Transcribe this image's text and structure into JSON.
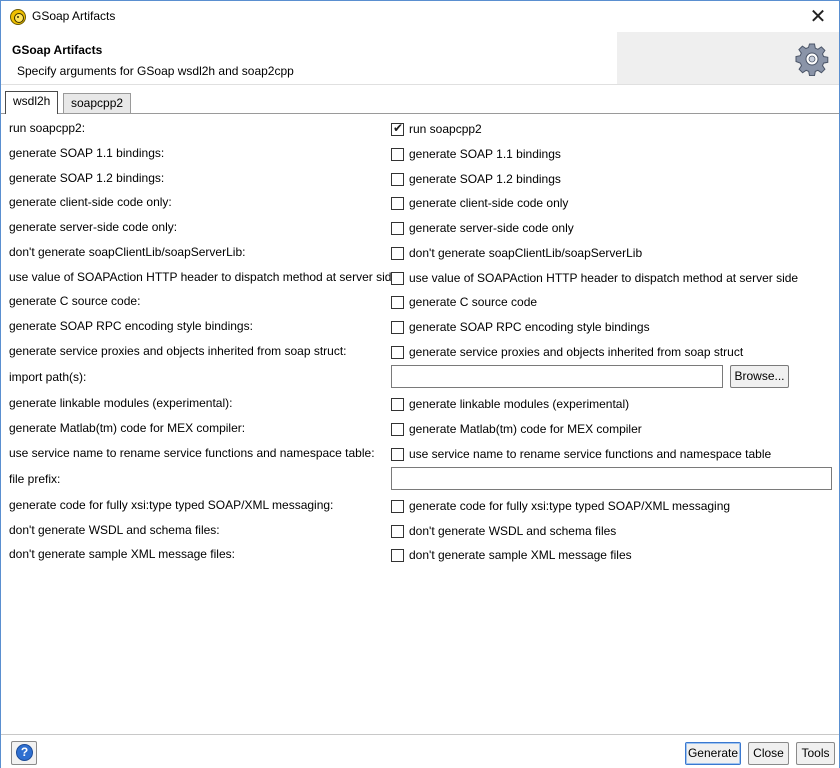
{
  "window": {
    "title": "GSoap Artifacts",
    "close_glyph": "✕"
  },
  "banner": {
    "title": "GSoap Artifacts",
    "subtitle": "Specify arguments for GSoap wsdl2h and soap2cpp",
    "icon": "gear-icon"
  },
  "tabs": [
    {
      "label": "wsdl2h",
      "active": true
    },
    {
      "label": "soapcpp2",
      "active": false
    }
  ],
  "form": {
    "run_soapcpp2": {
      "label": "run soapcpp2:",
      "cb": "run soapcpp2",
      "checked": true
    },
    "soap11": {
      "label": "generate SOAP 1.1 bindings:",
      "cb": "generate SOAP 1.1 bindings",
      "checked": false
    },
    "soap12": {
      "label": "generate SOAP 1.2 bindings:",
      "cb": "generate SOAP 1.2 bindings",
      "checked": false
    },
    "client_only": {
      "label": "generate client-side code only:",
      "cb": "generate client-side code only",
      "checked": false
    },
    "server_only": {
      "label": "generate server-side code only:",
      "cb": "generate server-side code only",
      "checked": false
    },
    "no_lib": {
      "label": "don't generate soapClientLib/soapServerLib:",
      "cb": "don't generate soapClientLib/soapServerLib",
      "checked": false
    },
    "soapaction": {
      "label": "use value of SOAPAction HTTP header to dispatch method at server side:",
      "cb": "use value of SOAPAction HTTP header to dispatch method at server side",
      "checked": false
    },
    "c_source": {
      "label": "generate C source code:",
      "cb": "generate C source code",
      "checked": false
    },
    "rpc": {
      "label": "generate SOAP RPC encoding style bindings:",
      "cb": "generate SOAP RPC encoding style bindings",
      "checked": false
    },
    "proxies": {
      "label": "generate service proxies and objects inherited from soap struct:",
      "cb": "generate service proxies and objects inherited from soap struct",
      "checked": false
    },
    "import_path": {
      "label": "import path(s):",
      "value": "",
      "browse": "Browse..."
    },
    "linkable": {
      "label": "generate linkable modules (experimental):",
      "cb": "generate linkable modules (experimental)",
      "checked": false
    },
    "matlab": {
      "label": "generate Matlab(tm) code for MEX compiler:",
      "cb": "generate Matlab(tm) code for MEX compiler",
      "checked": false
    },
    "service_name": {
      "label": "use service name to rename service functions and namespace table:",
      "cb": "use service name to rename service functions and namespace table",
      "checked": false
    },
    "file_prefix": {
      "label": "file prefix:",
      "value": ""
    },
    "xsi_type": {
      "label": "generate code for fully xsi:type typed SOAP/XML messaging:",
      "cb": "generate code for fully xsi:type typed SOAP/XML messaging",
      "checked": false
    },
    "no_wsdl": {
      "label": "don't generate WSDL and schema files:",
      "cb": "don't generate WSDL and schema files",
      "checked": false
    },
    "no_sample": {
      "label": "don't generate sample XML message files:",
      "cb": "don't generate sample XML message files",
      "checked": false
    }
  },
  "footer": {
    "help_glyph": "?",
    "generate": "Generate",
    "close": "Close",
    "tools": "Tools"
  }
}
